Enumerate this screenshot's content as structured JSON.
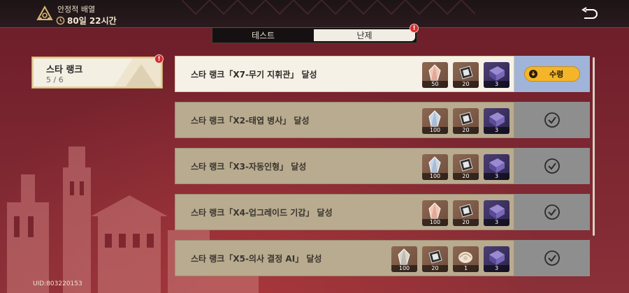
{
  "header": {
    "event_title": "안정적 배열",
    "timer": "80일 22시간"
  },
  "tabs": [
    {
      "label": "테스트",
      "selected": false
    },
    {
      "label": "난제",
      "selected": true,
      "badge": "!"
    }
  ],
  "side_card": {
    "title": "스타 랭크",
    "progress": "5 / 6",
    "badge": "!"
  },
  "missions": [
    {
      "label": "스타 랭크「X7-무기 지휘관」 달성",
      "state": "claimable",
      "rewards": [
        {
          "icon": "crystal-icon",
          "qty": "50"
        },
        {
          "icon": "chip-icon",
          "qty": "20"
        },
        {
          "icon": "box-icon",
          "qty": "3"
        }
      ]
    },
    {
      "label": "스타 랭크「X2-태엽 병사」 달성",
      "state": "completed",
      "rewards": [
        {
          "icon": "crystal-icon",
          "qty": "100"
        },
        {
          "icon": "chip-icon",
          "qty": "20"
        },
        {
          "icon": "box-icon",
          "qty": "3"
        }
      ]
    },
    {
      "label": "스타 랭크「X3-자동인형」 달성",
      "state": "completed",
      "rewards": [
        {
          "icon": "crystal-icon",
          "qty": "100"
        },
        {
          "icon": "chip-icon",
          "qty": "20"
        },
        {
          "icon": "box-icon",
          "qty": "3"
        }
      ]
    },
    {
      "label": "스타 랭크「X4-업그레이드 기갑」 달성",
      "state": "completed",
      "rewards": [
        {
          "icon": "crystal-icon",
          "qty": "100"
        },
        {
          "icon": "chip-icon",
          "qty": "20"
        },
        {
          "icon": "box-icon",
          "qty": "3"
        }
      ]
    },
    {
      "label": "스타 랭크「X5-의사 결정 AI」 달성",
      "state": "completed",
      "rewards": [
        {
          "icon": "crystal-icon",
          "qty": "100"
        },
        {
          "icon": "chip-icon",
          "qty": "20"
        },
        {
          "icon": "shell-icon",
          "qty": "1"
        },
        {
          "icon": "box-icon",
          "qty": "3"
        }
      ]
    }
  ],
  "claim_label": "수령",
  "uid": "UID:803220153",
  "colors": {
    "claim_button": "#f4b52a",
    "active_side": "#9fb4d8",
    "done_side": "#8e8e8e",
    "badge": "#d42b2b"
  }
}
